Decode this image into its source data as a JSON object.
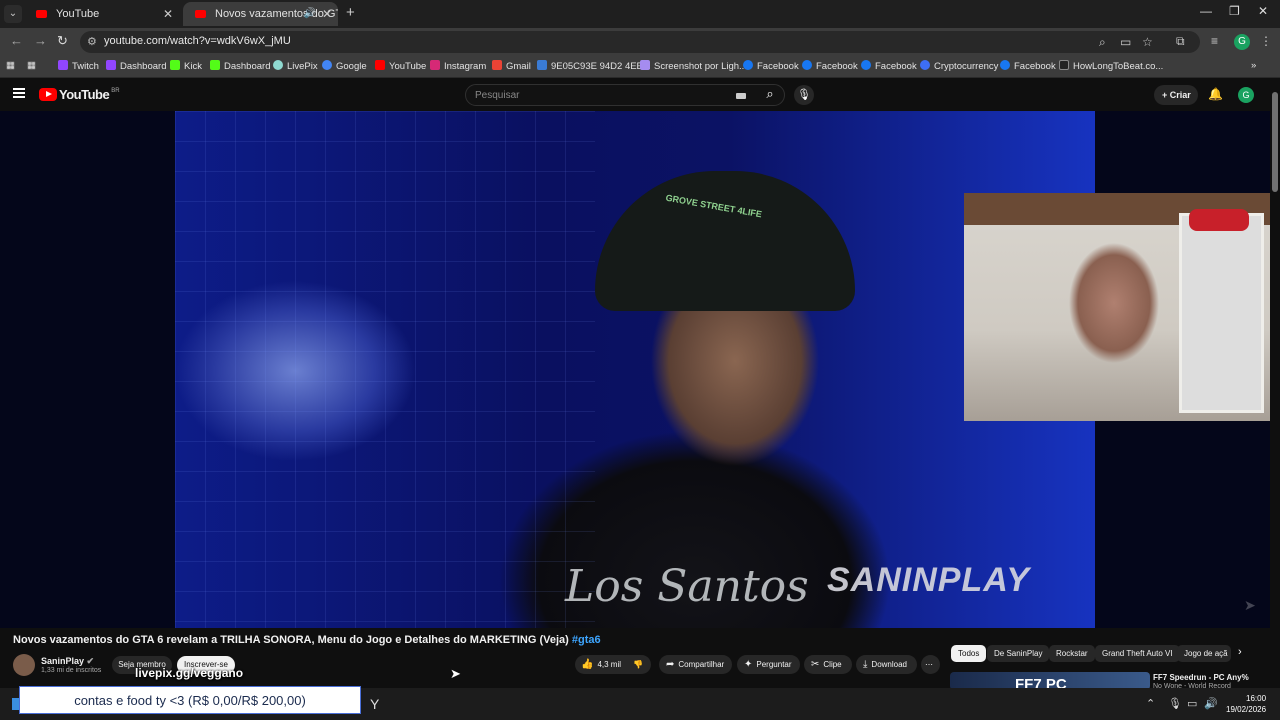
{
  "browser": {
    "tabs": [
      {
        "label": "YouTube",
        "active": false
      },
      {
        "label": "Novos vazamentos do GTA",
        "active": true
      }
    ],
    "url": "youtube.com/watch?v=wdkV6wX_jMU",
    "profile_initial": "G",
    "bookmarks": [
      "Twitch",
      "Dashboard",
      "Kick",
      "Dashboard",
      "LivePix",
      "Google",
      "YouTube",
      "Instagram",
      "Gmail",
      "9E05C93E 94D2 4EE...",
      "Screenshot por Ligh...",
      "Facebook",
      "Facebook",
      "Facebook",
      "Cryptocurrency",
      "Facebook",
      "HowLongToBeat.co..."
    ]
  },
  "youtube": {
    "logo": "YouTube",
    "logo_region": "BR",
    "search_placeholder": "Pesquisar",
    "create_label": "Criar",
    "avatar_initial": "G"
  },
  "video": {
    "shirt_text": "Los Santos",
    "watermark": "SANINPLAY",
    "cap_text": "GROVE STREET 4LIFE",
    "title": "Novos vazamentos do GTA 6 revelam a TRILHA SONORA, Menu do Jogo e Detalhes do MARKETING (Veja)",
    "hashtag": "#gta6"
  },
  "channel": {
    "name": "SaninPlay",
    "subscribers": "1,33 mi de inscritos",
    "member_label": "Seja membro",
    "subscribe_label": "Inscrever-se"
  },
  "actions": {
    "likes": "4,3 mil",
    "share": "Compartilhar",
    "ask": "Perguntar",
    "clip": "Clipe",
    "download": "Download"
  },
  "chips": [
    "Todos",
    "De SaninPlay",
    "Rockstar",
    "Grand Theft Auto VI",
    "Jogo de açã"
  ],
  "recommended": {
    "thumb_text": "FF7 PC",
    "title": "FF7 Speedrun - PC Any%",
    "subtitle": "No Wone - World Record"
  },
  "overlay": {
    "livepix": "livepix.gg/veggano",
    "donation": "contas e food ty <3 (R$ 0,00/R$ 200,00)"
  },
  "taskbar": {
    "time": "16:00",
    "date": "19/02/2026"
  },
  "colors": {
    "youtube_red": "#ff0000",
    "link_blue": "#3ea6ff",
    "background": "#0f0f0f"
  }
}
